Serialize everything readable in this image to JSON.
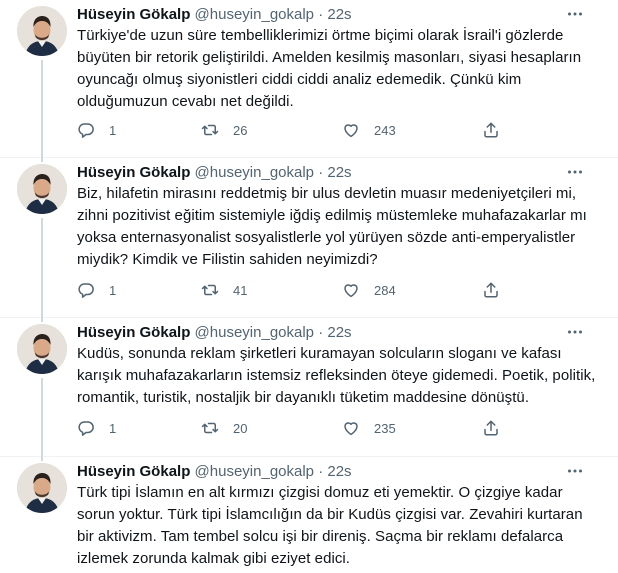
{
  "tweets": [
    {
      "name": "Hüseyin Gökalp",
      "handle": "@huseyin_gokalp",
      "dot": "·",
      "time": "22s",
      "text": "Türkiye'de uzun süre tembelliklerimizi örtme biçimi olarak İsrail'i gözlerde büyüten bir retorik geliştirildi. Amelden kesilmiş masonları, siyasi hesapların oyuncağı olmuş siyonistleri ciddi ciddi analiz edemedik. Çünkü kim olduğumuzun cevabı net değildi.",
      "replies": "1",
      "retweets": "26",
      "likes": "243"
    },
    {
      "name": "Hüseyin Gökalp",
      "handle": "@huseyin_gokalp",
      "dot": "·",
      "time": "22s",
      "text": "Biz, hilafetin mirasını reddetmiş bir ulus devletin muasır medeniyetçileri mi, zihni pozitivist eğitim sistemiyle iğdiş edilmiş müstemleke muhafazakarlar mı yoksa enternasyonalist sosyalistlerle yol yürüyen sözde anti-emperyalistler miydik? Kimdik ve Filistin sahiden neyimizdi?",
      "replies": "1",
      "retweets": "41",
      "likes": "284"
    },
    {
      "name": "Hüseyin Gökalp",
      "handle": "@huseyin_gokalp",
      "dot": "·",
      "time": "22s",
      "text": "Kudüs, sonunda reklam şirketleri kuramayan solcuların sloganı ve kafası karışık muhafazakarların istemsiz refleksinden öteye gidemedi. Poetik, politik, romantik, turistik, nostaljik bir dayanıklı tüketim maddesine dönüştü.",
      "replies": "1",
      "retweets": "20",
      "likes": "235"
    },
    {
      "name": "Hüseyin Gökalp",
      "handle": "@huseyin_gokalp",
      "dot": "·",
      "time": "22s",
      "text": "Türk tipi İslamın en alt kırmızı çizgisi domuz eti yemektir. O çizgiye kadar sorun yoktur. Türk tipi İslamcılığın da bir Kudüs çizgisi var. Zevahiri kurtaran bir aktivizm. Tam tembel solcu işi bir direniş. Saçma bir reklamı defalarca izlemek zorunda kalmak gibi eziyet edici."
    }
  ],
  "icons": {
    "reply": "reply-icon",
    "retweet": "retweet-icon",
    "like": "like-icon",
    "share": "share-icon",
    "more": "more-icon"
  },
  "colors": {
    "text": "#0f1419",
    "muted": "#536471",
    "thread_line": "#cfd9de"
  }
}
